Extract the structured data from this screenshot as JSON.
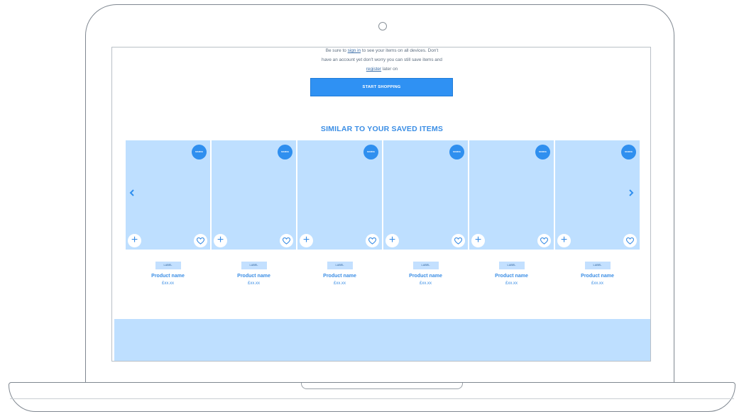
{
  "intro": {
    "line1_pre": "Be sure to ",
    "line1_link": "sign in",
    "line1_post": " to see your items on all devices. Don't",
    "line2": "have an account yet don't worry you can still save items and",
    "line3_link": "register",
    "line3_post": " later on"
  },
  "cta": {
    "label": "START SHOPPING"
  },
  "section": {
    "title": "SIMILAR TO YOUR SAVED ITEMS"
  },
  "carousel": {
    "prev_icon": "chevron-left-icon",
    "next_icon": "chevron-right-icon",
    "add_icon": "plus-icon",
    "fav_icon": "heart-icon",
    "items": [
      {
        "badge": "SOURCE",
        "label": "LABEL",
        "name": "Product name",
        "price": "£xx.xx"
      },
      {
        "badge": "SOURCE",
        "label": "LABEL",
        "name": "Product name",
        "price": "£xx.xx"
      },
      {
        "badge": "SOURCE",
        "label": "LABEL",
        "name": "Product name",
        "price": "£xx.xx"
      },
      {
        "badge": "SOURCE",
        "label": "LABEL",
        "name": "Product name",
        "price": "£xx.xx"
      },
      {
        "badge": "SOURCE",
        "label": "LABEL",
        "name": "Product name",
        "price": "£xx.xx"
      },
      {
        "badge": "SOURCE",
        "label": "LABEL",
        "name": "Product name",
        "price": "£xx.xx"
      }
    ]
  },
  "colors": {
    "accent": "#2f91f3",
    "tile": "#bedfff",
    "title": "#3b8ee5"
  }
}
